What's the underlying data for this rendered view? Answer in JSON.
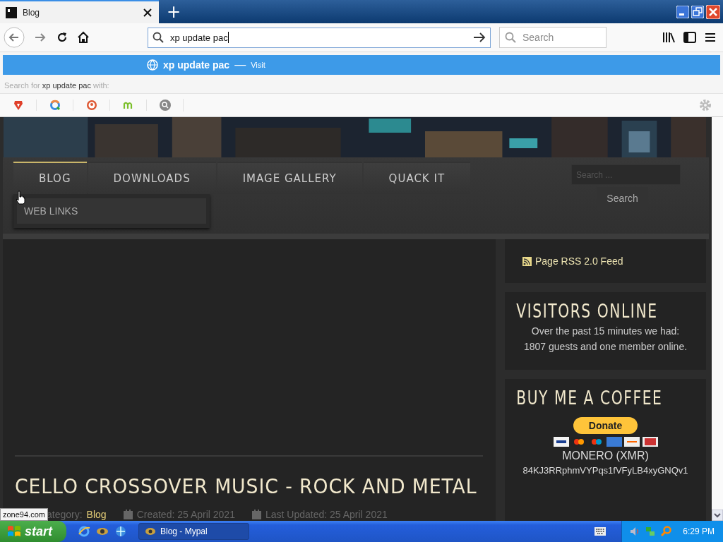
{
  "browser": {
    "tabs": [
      {
        "title": "Blog",
        "selected": true
      }
    ],
    "new_tab": "+",
    "address_bar": {
      "value": "xp update pac"
    },
    "search_field": {
      "placeholder": "Search"
    }
  },
  "suggestions": {
    "items": [
      {
        "text": "xp update pac",
        "separator": "—",
        "action": "Visit",
        "selected": true
      }
    ],
    "search_with": {
      "prefix": "Search for",
      "query": "xp update pac",
      "suffix": "with:"
    }
  },
  "page": {
    "nav": [
      {
        "label": "BLOG",
        "selected": true
      },
      {
        "label": "DOWNLOADS",
        "selected": false
      },
      {
        "label": "IMAGE GALLERY",
        "selected": false
      },
      {
        "label": "QUACK IT",
        "selected": false
      }
    ],
    "submenu": [
      {
        "label": "WEB LINKS"
      }
    ],
    "search": {
      "placeholder": "Search ...",
      "button": "Search"
    },
    "article": {
      "title": "CELLO CROSSOVER MUSIC - ROCK AND METAL",
      "category_label": "ategory:",
      "category": "Blog",
      "created": "Created: 25 April 2021",
      "updated": "Last Updated: 25 April 2021"
    },
    "sidebar": {
      "rss": "Page RSS 2.0 Feed",
      "visitors": {
        "title": "VISITORS ONLINE",
        "text": "Over the past 15 minutes we had: 1807 guests and one member online."
      },
      "coffee": {
        "title": "BUY ME A COFFEE",
        "donate": "Donate",
        "currency": "MONERO (XMR)",
        "address": "84KJ3RRphmVYPqs1fVFyLB4xyGNQv1"
      }
    }
  },
  "status_text": "zone94.com",
  "taskbar": {
    "start": "start",
    "tasks": [
      {
        "label": "Blog - Mypal",
        "selected": true
      }
    ],
    "clock": "6:29 PM"
  }
}
